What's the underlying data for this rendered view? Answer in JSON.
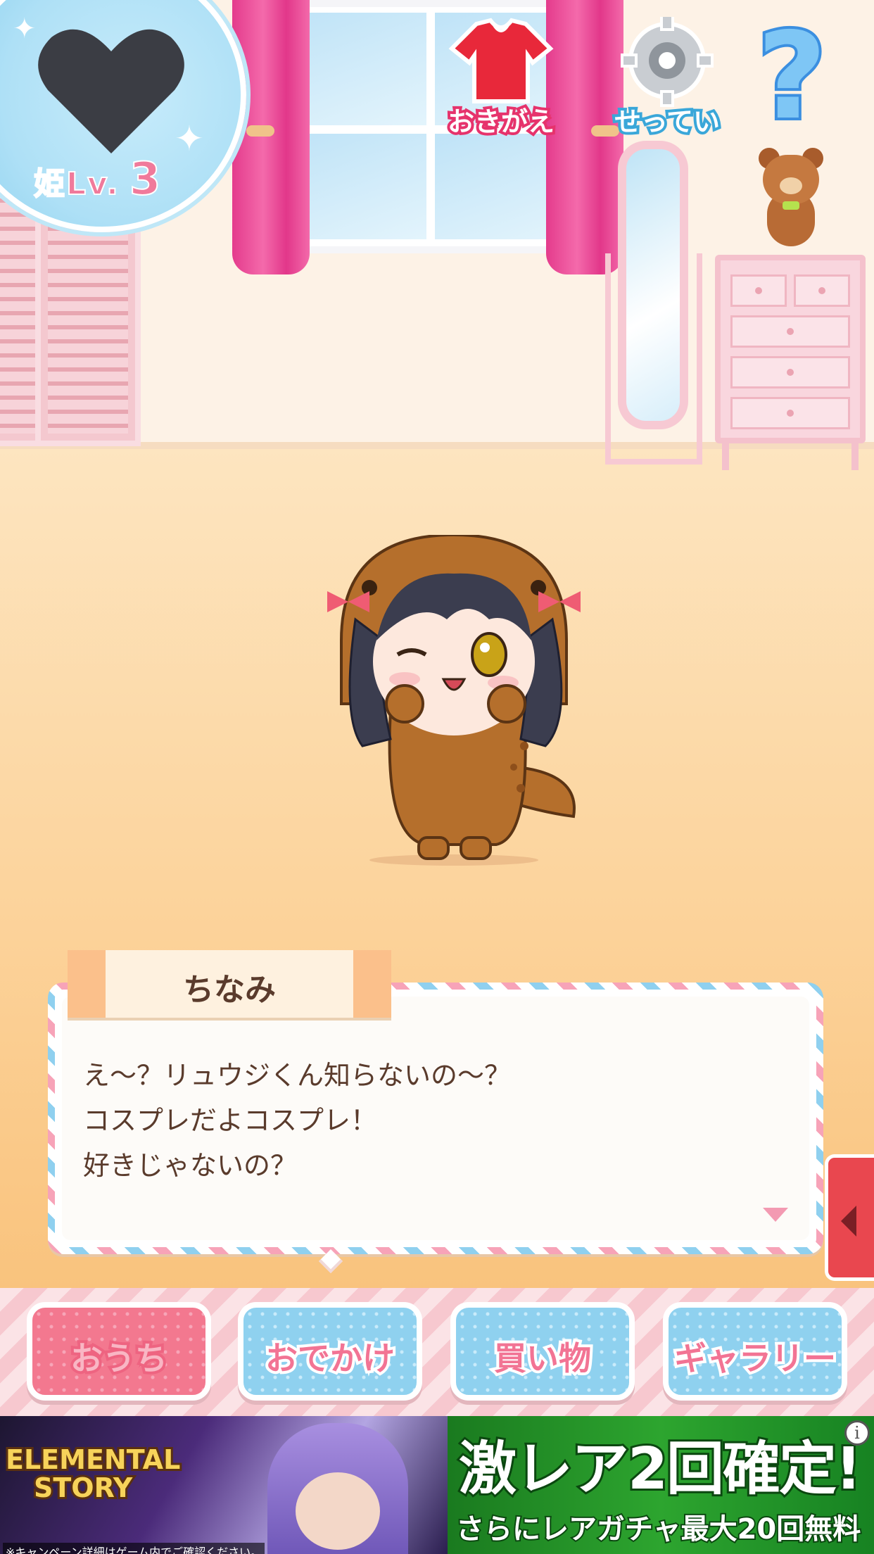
{
  "level_badge": {
    "label": "姫Lv.",
    "level": "3"
  },
  "top_buttons": {
    "dress_up": "おきがえ",
    "settings": "せってい",
    "help": "?"
  },
  "dialogue": {
    "speaker": "ちなみ",
    "text": "え～？リュウジくん知らないの～？\nコスプレだよコスプレ！\n好きじゃないの？"
  },
  "bottom_nav": {
    "items": [
      {
        "label": "おうち",
        "active": true
      },
      {
        "label": "おでかけ",
        "active": false
      },
      {
        "label": "買い物",
        "active": false
      },
      {
        "label": "ギャラリー",
        "active": false
      }
    ]
  },
  "ad": {
    "logo_line1": "ELEMENTAL",
    "logo_line2": "STORY",
    "headline": "激レア2回確定!",
    "subline": "さらにレアガチャ最大20回無料",
    "disclaimer": "※キャンペーン詳細はゲーム内でご確認ください。",
    "info": "i"
  },
  "colors": {
    "accent_pink": "#f3788f",
    "accent_blue": "#8fd1ef",
    "ad_green": "#2da52f"
  },
  "icons": {
    "heart": "heart-icon",
    "dress": "dress-icon",
    "gear": "gear-icon",
    "help": "question-icon",
    "next": "triangle-down-icon",
    "side_tab": "chevron-left-icon"
  }
}
